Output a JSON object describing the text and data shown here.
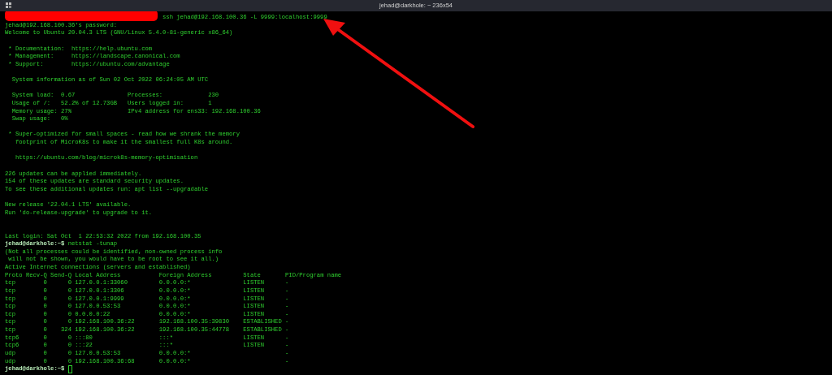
{
  "window": {
    "title": "jehad@darkhole: ~ 236x54"
  },
  "lines": [
    {
      "kind": "redacted_prompt",
      "command": "ssh jehad@192.168.100.36 -L 9999:localhost:9999"
    },
    {
      "kind": "text",
      "text": "jehad@192.168.100.36's password:"
    },
    {
      "kind": "text",
      "text": "Welcome to Ubuntu 20.04.3 LTS (GNU/Linux 5.4.0-81-generic x86_64)"
    },
    {
      "kind": "blank"
    },
    {
      "kind": "text",
      "text": " * Documentation:  https://help.ubuntu.com"
    },
    {
      "kind": "text",
      "text": " * Management:     https://landscape.canonical.com"
    },
    {
      "kind": "text",
      "text": " * Support:        https://ubuntu.com/advantage"
    },
    {
      "kind": "blank"
    },
    {
      "kind": "text",
      "text": "  System information as of Sun 02 Oct 2022 06:24:05 AM UTC"
    },
    {
      "kind": "blank"
    },
    {
      "kind": "text",
      "text": "  System load:  0.67               Processes:             230"
    },
    {
      "kind": "text",
      "text": "  Usage of /:   52.2% of 12.73GB   Users logged in:       1"
    },
    {
      "kind": "text",
      "text": "  Memory usage: 27%                IPv4 address for ens33: 192.168.100.36"
    },
    {
      "kind": "text",
      "text": "  Swap usage:   0%"
    },
    {
      "kind": "blank"
    },
    {
      "kind": "text",
      "text": " * Super-optimized for small spaces - read how we shrank the memory"
    },
    {
      "kind": "text",
      "text": "   footprint of MicroK8s to make it the smallest full K8s around."
    },
    {
      "kind": "blank"
    },
    {
      "kind": "text",
      "text": "   https://ubuntu.com/blog/microk8s-memory-optimisation"
    },
    {
      "kind": "blank"
    },
    {
      "kind": "text",
      "text": "226 updates can be applied immediately."
    },
    {
      "kind": "text",
      "text": "154 of these updates are standard security updates."
    },
    {
      "kind": "text",
      "text": "To see these additional updates run: apt list --upgradable"
    },
    {
      "kind": "blank"
    },
    {
      "kind": "text",
      "text": "New release '22.04.1 LTS' available."
    },
    {
      "kind": "text",
      "text": "Run 'do-release-upgrade' to upgrade to it."
    },
    {
      "kind": "blank"
    },
    {
      "kind": "blank"
    },
    {
      "kind": "text",
      "text": "Last login: Sat Oct  1 22:53:32 2022 from 192.168.100.35"
    },
    {
      "kind": "prompt",
      "prompt": "jehad@darkhole:~$",
      "command": "netstat -tunap"
    },
    {
      "kind": "text",
      "text": "(Not all processes could be identified, non-owned process info"
    },
    {
      "kind": "text",
      "text": " will not be shown, you would have to be root to see it all.)"
    },
    {
      "kind": "text",
      "text": "Active Internet connections (servers and established)"
    },
    {
      "kind": "text",
      "text": "Proto Recv-Q Send-Q Local Address           Foreign Address         State       PID/Program name"
    },
    {
      "kind": "text",
      "text": "tcp        0      0 127.0.0.1:33060         0.0.0.0:*               LISTEN      -"
    },
    {
      "kind": "text",
      "text": "tcp        0      0 127.0.0.1:3306          0.0.0.0:*               LISTEN      -"
    },
    {
      "kind": "text",
      "text": "tcp        0      0 127.0.0.1:9999          0.0.0.0:*               LISTEN      -"
    },
    {
      "kind": "text",
      "text": "tcp        0      0 127.0.0.53:53           0.0.0.0:*               LISTEN      -"
    },
    {
      "kind": "text",
      "text": "tcp        0      0 0.0.0.0:22              0.0.0.0:*               LISTEN      -"
    },
    {
      "kind": "text",
      "text": "tcp        0      0 192.168.100.36:22       192.168.100.35:39830    ESTABLISHED -"
    },
    {
      "kind": "text",
      "text": "tcp        0    324 192.168.100.36:22       192.168.100.35:44778    ESTABLISHED -"
    },
    {
      "kind": "text",
      "text": "tcp6       0      0 :::80                   :::*                    LISTEN      -"
    },
    {
      "kind": "text",
      "text": "tcp6       0      0 :::22                   :::*                    LISTEN      -"
    },
    {
      "kind": "text",
      "text": "udp        0      0 127.0.0.53:53           0.0.0.0:*                           -"
    },
    {
      "kind": "text",
      "text": "udp        0      0 192.168.100.36:68       0.0.0.0:*                           -"
    },
    {
      "kind": "prompt",
      "prompt": "jehad@darkhole:~$",
      "cursor": true
    }
  ]
}
